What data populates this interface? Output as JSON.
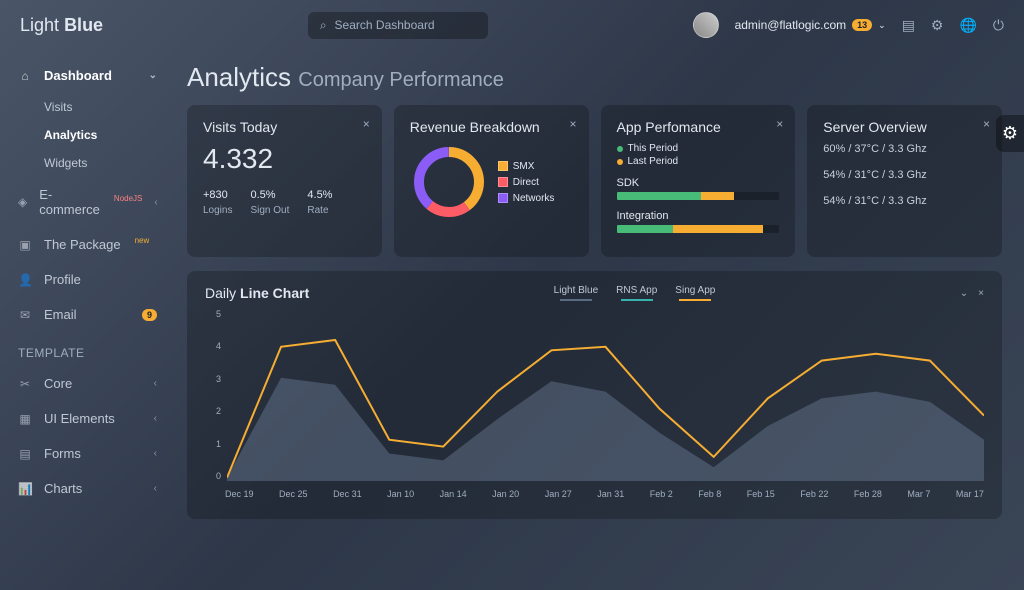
{
  "brand": {
    "a": "Light",
    "b": "Blue"
  },
  "search": {
    "placeholder": "Search Dashboard"
  },
  "user": {
    "email": "admin@flatlogic.com",
    "badge": "13"
  },
  "nav": {
    "dashboard": "Dashboard",
    "visits": "Visits",
    "analytics": "Analytics",
    "widgets": "Widgets",
    "ecommerce": "E-commerce",
    "ecommerce_tag": "NodeJS",
    "package": "The Package",
    "package_tag": "new",
    "profile": "Profile",
    "email": "Email",
    "email_badge": "9",
    "template_label": "TEMPLATE",
    "core": "Core",
    "ui": "UI Elements",
    "forms": "Forms",
    "charts": "Charts"
  },
  "title": {
    "main": "Analytics",
    "sub": "Company Performance"
  },
  "visits": {
    "title": "Visits Today",
    "value": "4.332",
    "s1": {
      "v": "+830",
      "l": "Logins"
    },
    "s2": {
      "v": "0.5%",
      "l": "Sign Out"
    },
    "s3": {
      "v": "4.5%",
      "l": "Rate"
    }
  },
  "revenue": {
    "title": "Revenue Breakdown",
    "l1": "SMX",
    "l2": "Direct",
    "l3": "Networks"
  },
  "app": {
    "title": "App Perfomance",
    "p1": "This Period",
    "p2": "Last Period",
    "sec1": "SDK",
    "sec2": "Integration"
  },
  "server": {
    "title": "Server Overview",
    "l1": "60% / 37°C / 3.3 Ghz",
    "l2": "54% / 31°C / 3.3 Ghz",
    "l3": "54% / 31°C / 3.3 Ghz"
  },
  "colors": {
    "yellow": "#f6ad32",
    "orange": "#ed8936",
    "red": "#fc5c65",
    "purple": "#8b5cf6",
    "green": "#48bb78",
    "teal": "#38b2ac"
  },
  "chart_data": {
    "type": "line",
    "title_a": "Daily",
    "title_b": "Line Chart",
    "legend": [
      "Light Blue",
      "RNS App",
      "Sing App"
    ],
    "legend_colors": [
      "#5a6b82",
      "#38b2ac",
      "#f6ad32"
    ],
    "ylim": [
      0,
      5
    ],
    "yticks": [
      0,
      1,
      2,
      3,
      4,
      5
    ],
    "categories": [
      "Dec 19",
      "Dec 25",
      "Dec 31",
      "Jan 10",
      "Jan 14",
      "Jan 20",
      "Jan 27",
      "Jan 31",
      "Feb 2",
      "Feb 8",
      "Feb 15",
      "Feb 22",
      "Feb 28",
      "Mar 7",
      "Mar 17"
    ],
    "series": [
      {
        "name": "Sing App",
        "values": [
          0.1,
          3.9,
          4.1,
          1.2,
          1.0,
          2.6,
          3.8,
          3.9,
          2.1,
          0.7,
          2.4,
          3.5,
          3.7,
          3.5,
          1.9
        ]
      },
      {
        "name": "Light Blue",
        "values": [
          0.1,
          3.0,
          2.8,
          0.8,
          0.6,
          1.8,
          2.9,
          2.6,
          1.4,
          0.4,
          1.6,
          2.4,
          2.6,
          2.3,
          1.2
        ]
      }
    ]
  }
}
